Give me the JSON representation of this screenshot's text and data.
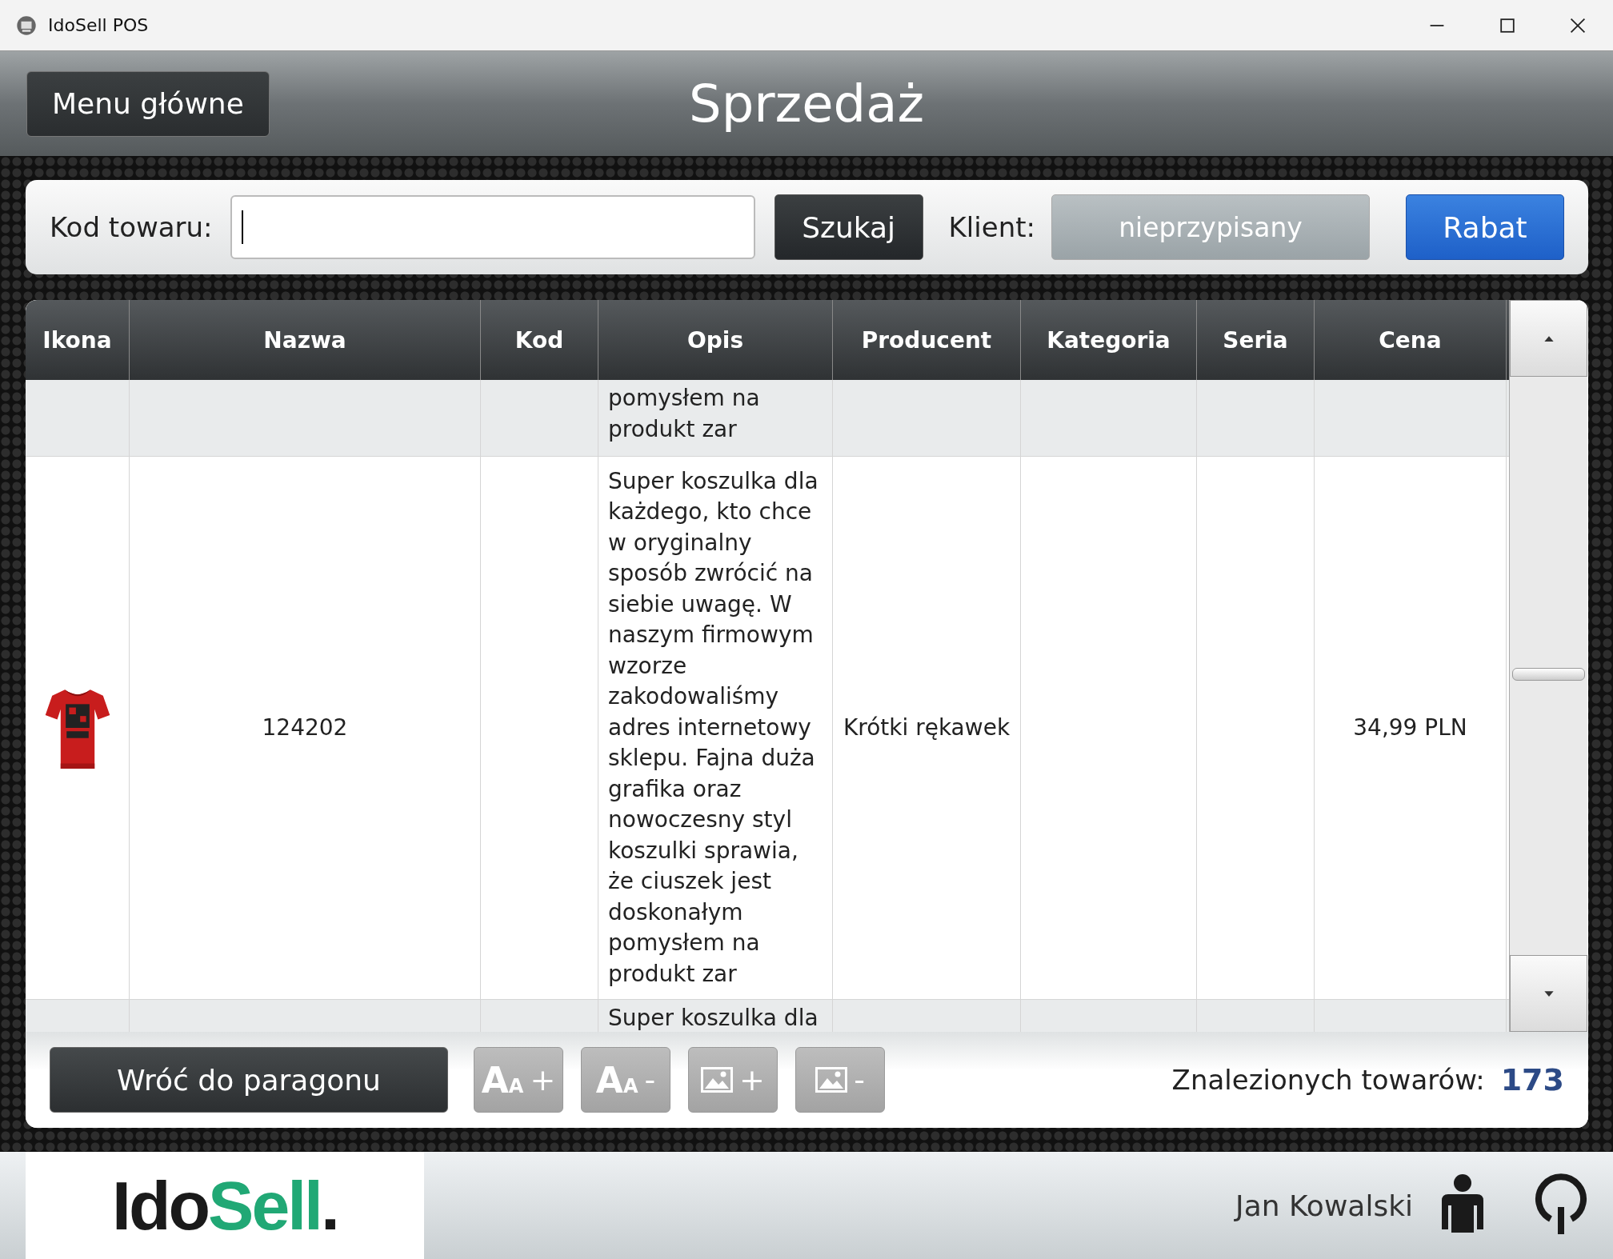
{
  "window": {
    "title": "IdoSell POS"
  },
  "header": {
    "menu_button": "Menu główne",
    "title": "Sprzedaż"
  },
  "search": {
    "label": "Kod towaru:",
    "button": "Szukaj",
    "client_label": "Klient:",
    "client_button": "nieprzypisany",
    "discount_button": "Rabat"
  },
  "table": {
    "columns": [
      "Ikona",
      "Nazwa",
      "Kod",
      "Opis",
      "Producent",
      "Kategoria",
      "Seria",
      "Cena"
    ],
    "rows": [
      {
        "kind": "partial-top",
        "image": false,
        "description": "pomysłem na produkt zar"
      },
      {
        "kind": "full",
        "image": true,
        "name": "124202",
        "description": "Super koszulka dla każdego, kto chce w oryginalny sposób zwrócić na siebie uwagę. W naszym firmowym wzorze zakodowaliśmy adres internetowy sklepu. Fajna duża grafika oraz nowoczesny styl koszulki sprawia, że ciuszek jest doskonałym pomysłem na produkt zar",
        "producer": "Krótki rękawek",
        "price": "34,99 PLN"
      },
      {
        "kind": "partial-bottom",
        "image": false,
        "description": "Super koszulka dla"
      }
    ]
  },
  "toolbar": {
    "back_button": "Wróć do paragonu",
    "tools": [
      {
        "kind": "text-size",
        "glyphs": [
          "A",
          "A"
        ],
        "sign": "+"
      },
      {
        "kind": "text-size",
        "glyphs": [
          "A",
          "A"
        ],
        "sign": "-"
      },
      {
        "kind": "image-size",
        "sign": "+"
      },
      {
        "kind": "image-size",
        "sign": "-"
      }
    ],
    "found_label": "Znalezionych towarów:",
    "found_count": "173"
  },
  "footer": {
    "logo": [
      "Ido",
      "Sell",
      "."
    ],
    "user": "Jan Kowalski"
  }
}
